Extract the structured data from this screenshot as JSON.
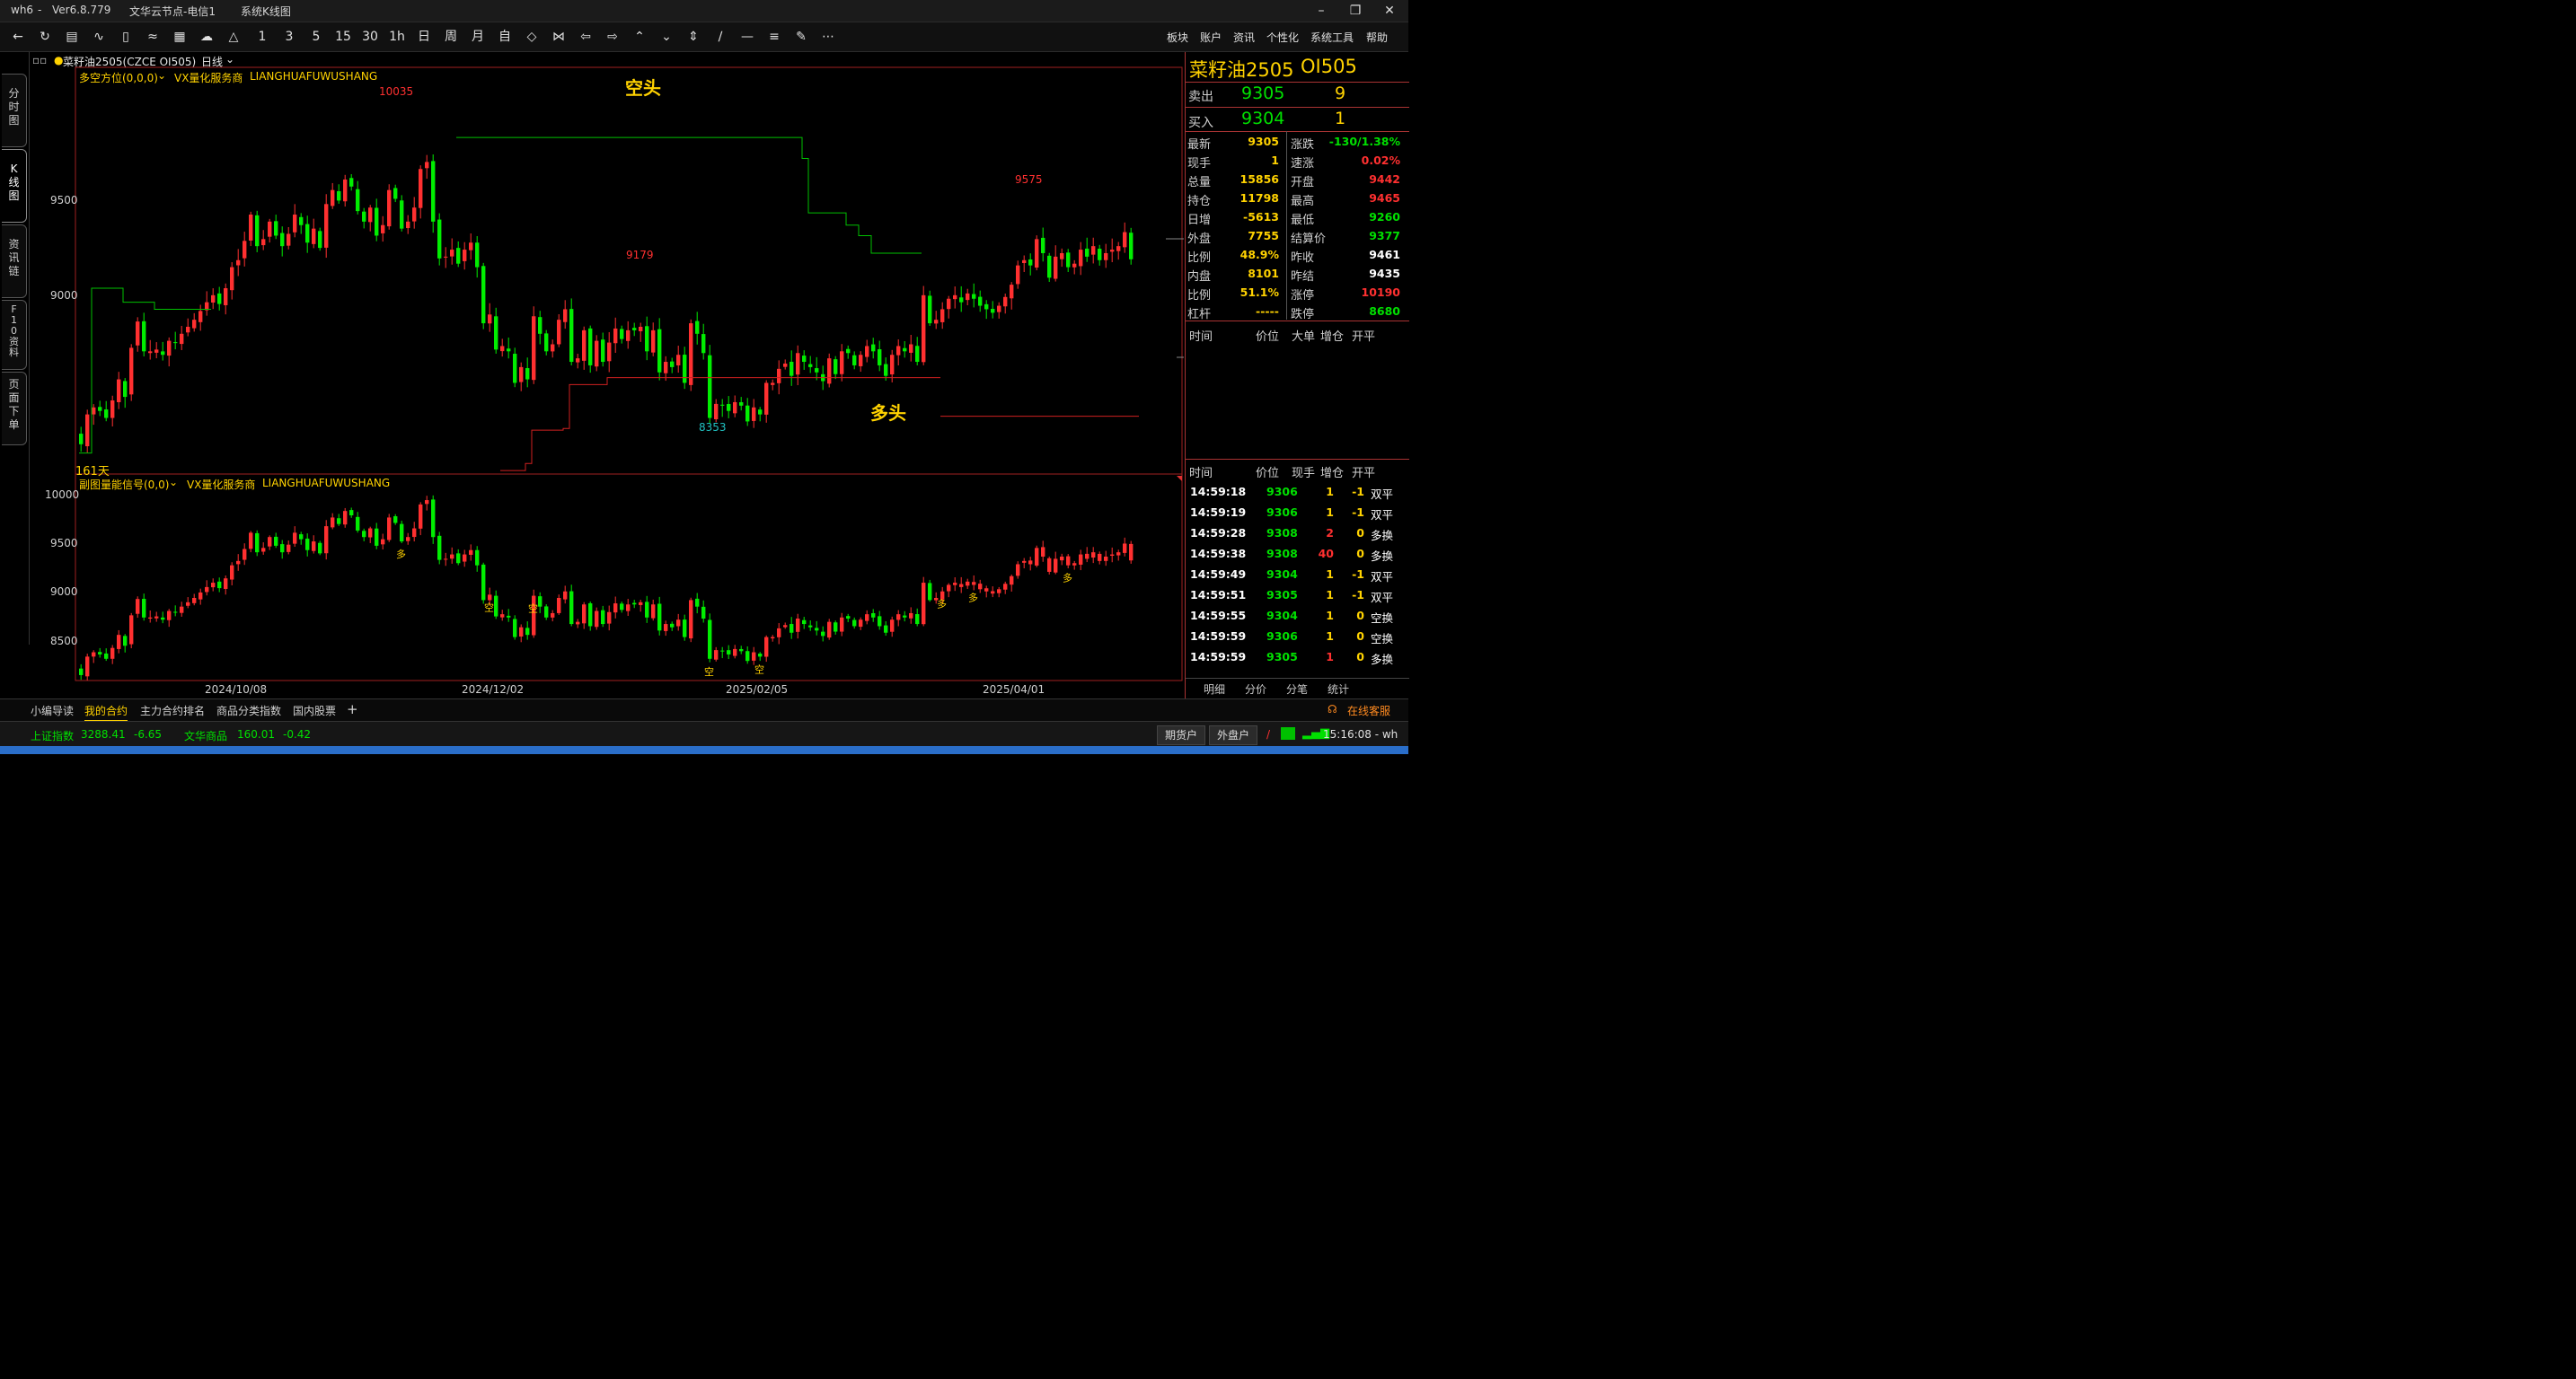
{
  "titlebar": {
    "app": "wh6",
    "sep": "-",
    "version": "Ver6.8.779",
    "server": "文华云节点-电信1",
    "view": "系统K线图"
  },
  "toolbar": {
    "periods": [
      "1",
      "3",
      "5",
      "15",
      "30",
      "1h",
      "日",
      "周",
      "月",
      "自"
    ],
    "menus": [
      "板块",
      "账户",
      "资讯",
      "个性化",
      "系统工具",
      "帮助"
    ]
  },
  "left_tabs": [
    "分\n时\n图",
    "K\n线\n图",
    "资\n讯\n链",
    "F\n1\n0\n资\n料",
    "页\n面\n下\n单"
  ],
  "chart_header": {
    "symbol": "菜籽油2505(CZCE OI505)",
    "period": "日线",
    "main_indicator": "多空方位(0,0,0)",
    "vendor": "VX量化服务商",
    "vendor_pinyin": "LIANGHUAFUWUSHANG",
    "bars_label": "161天",
    "sub_indicator": "副图量能信号(0,0)",
    "sub_vendor": "VX量化服务商",
    "sub_vendor_pinyin": "LIANGHUAFUWUSHANG"
  },
  "annotations": {
    "short_label": "空头",
    "long_label": "多头",
    "high1": "10035",
    "high2": "9179",
    "low1": "8353",
    "high3": "9575",
    "signal_long": "多",
    "signal_short": "空"
  },
  "main_axis": {
    "labels": [
      "9500",
      "9000"
    ]
  },
  "sub_axis": {
    "labels": [
      "10000",
      "9500",
      "9000",
      "8500"
    ]
  },
  "date_axis": {
    "labels": [
      "2024/10/08",
      "2024/12/02",
      "2025/02/05",
      "2025/04/01"
    ]
  },
  "chart_data": {
    "type": "candlestick",
    "main_ylim": [
      8080,
      10400
    ],
    "sub_ylim": [
      8200,
      10100
    ],
    "colors": {
      "up": "#ff3030",
      "down": "#00ee00",
      "short_line": "#00c000",
      "long_line": "#d02020"
    },
    "closes": [
      8250,
      8420,
      8460,
      8440,
      8400,
      8500,
      8620,
      8520,
      8800,
      8950,
      8780,
      8780,
      8790,
      8760,
      8840,
      8830,
      8880,
      8920,
      8960,
      9010,
      9060,
      9100,
      9050,
      9140,
      9260,
      9300,
      9410,
      9560,
      9380,
      9420,
      9520,
      9440,
      9380,
      9450,
      9560,
      9500,
      9400,
      9480,
      9370,
      9620,
      9700,
      9640,
      9760,
      9720,
      9580,
      9520,
      9600,
      9440,
      9500,
      9700,
      9650,
      9480,
      9520,
      9600,
      9820,
      9860,
      9520,
      9310,
      9320,
      9360,
      9280,
      9360,
      9400,
      9260,
      8940,
      8990,
      8790,
      8810,
      8780,
      8600,
      8690,
      8620,
      8980,
      8880,
      8780,
      8820,
      8960,
      9020,
      8720,
      8740,
      8900,
      8700,
      8840,
      8720,
      8830,
      8910,
      8850,
      8900,
      8900,
      8920,
      8780,
      8900,
      8660,
      8720,
      8690,
      8760,
      8600,
      8940,
      8880,
      8770,
      8400,
      8480,
      8470,
      8440,
      8490,
      8470,
      8380,
      8460,
      8420,
      8600,
      8600,
      8680,
      8710,
      8640,
      8770,
      8720,
      8690,
      8660,
      8610,
      8740,
      8650,
      8780,
      8770,
      8700,
      8760,
      8810,
      8780,
      8700,
      8640,
      8760,
      8810,
      8780,
      8820,
      8720,
      9100,
      8940,
      8960,
      9020,
      9080,
      9100,
      9060,
      9110,
      9080,
      9040,
      9020,
      9000,
      9040,
      9090,
      9160,
      9270,
      9300,
      9270,
      9420,
      9340,
      9200,
      9320,
      9340,
      9260,
      9280,
      9360,
      9320,
      9380,
      9300,
      9340,
      9360,
      9380,
      9460,
      9305
    ],
    "short_line": {
      "start_index": 60,
      "break_index": 136,
      "level_start": 10000,
      "steps": [
        [
          60,
          10000
        ],
        [
          114,
          10000
        ],
        [
          115,
          9880
        ],
        [
          116,
          9570
        ],
        [
          120,
          9570
        ],
        [
          122,
          9500
        ],
        [
          124,
          9440
        ],
        [
          126,
          9340
        ],
        [
          134,
          9340
        ]
      ]
    },
    "long_line": {
      "points": [
        [
          0,
          8200
        ],
        [
          1,
          8200
        ],
        [
          2,
          9140
        ],
        [
          6,
          9140
        ],
        [
          7,
          9060
        ],
        [
          11,
          9060
        ],
        [
          12,
          9020
        ],
        [
          21,
          9020
        ]
      ],
      "second": [
        [
          67,
          8100
        ],
        [
          70,
          8100
        ],
        [
          71,
          8140
        ],
        [
          72,
          8330
        ],
        [
          77,
          8340
        ],
        [
          78,
          8590
        ],
        [
          83,
          8590
        ],
        [
          84,
          8630
        ],
        [
          101,
          8630
        ],
        [
          137,
          8630
        ]
      ]
    },
    "long_level": 8410,
    "sub_signals": [
      [
        51,
        "多"
      ],
      [
        65,
        "空"
      ],
      [
        72,
        "空"
      ],
      [
        100,
        "空"
      ],
      [
        108,
        "空"
      ],
      [
        137,
        "多"
      ],
      [
        142,
        "多"
      ],
      [
        157,
        "多"
      ]
    ]
  },
  "quote": {
    "title": "菜籽油2505",
    "code": "OI505",
    "ask_label": "卖出",
    "ask_price": "9305",
    "ask_vol": "9",
    "bid_label": "买入",
    "bid_price": "9304",
    "bid_vol": "1",
    "rows": [
      {
        "l1": "最新",
        "v1": "9305",
        "c1": "y",
        "l2": "涨跌",
        "v2": "-130/1.38%",
        "c2": "g"
      },
      {
        "l1": "现手",
        "v1": "1",
        "c1": "y",
        "l2": "速涨",
        "v2": "0.02%",
        "c2": "r"
      },
      {
        "l1": "总量",
        "v1": "15856",
        "c1": "y",
        "l2": "开盘",
        "v2": "9442",
        "c2": "r"
      },
      {
        "l1": "持仓",
        "v1": "11798",
        "c1": "y",
        "l2": "最高",
        "v2": "9465",
        "c2": "r"
      },
      {
        "l1": "日增",
        "v1": "-5613",
        "c1": "y",
        "l2": "最低",
        "v2": "9260",
        "c2": "g"
      },
      {
        "l1": "外盘",
        "v1": "7755",
        "c1": "y",
        "l2": "结算价",
        "v2": "9377",
        "c2": "g"
      },
      {
        "l1": "比例",
        "v1": "48.9%",
        "c1": "y",
        "l2": "昨收",
        "v2": "9461",
        "c2": "w"
      },
      {
        "l1": "内盘",
        "v1": "8101",
        "c1": "y",
        "l2": "昨结",
        "v2": "9435",
        "c2": "w"
      },
      {
        "l1": "比例",
        "v1": "51.1%",
        "c1": "y",
        "l2": "涨停",
        "v2": "10190",
        "c2": "r"
      },
      {
        "l1": "杠杆",
        "v1": "-----",
        "c1": "y",
        "l2": "跌停",
        "v2": "8680",
        "c2": "g"
      }
    ],
    "bigorder_header": [
      "时间",
      "价位",
      "大单",
      "增仓",
      "开平"
    ],
    "tick_header": [
      "时间",
      "价位",
      "现手",
      "增仓",
      "开平"
    ],
    "ticks": [
      {
        "t": "14:59:18",
        "p": "9306",
        "v": "1",
        "vc": "y",
        "d": "-1",
        "k": "双平"
      },
      {
        "t": "14:59:19",
        "p": "9306",
        "v": "1",
        "vc": "y",
        "d": "-1",
        "k": "双平"
      },
      {
        "t": "14:59:28",
        "p": "9308",
        "v": "2",
        "vc": "r",
        "d": "0",
        "k": "多换"
      },
      {
        "t": "14:59:38",
        "p": "9308",
        "v": "40",
        "vc": "r",
        "d": "0",
        "k": "多换"
      },
      {
        "t": "14:59:49",
        "p": "9304",
        "v": "1",
        "vc": "y",
        "d": "-1",
        "k": "双平"
      },
      {
        "t": "14:59:51",
        "p": "9305",
        "v": "1",
        "vc": "y",
        "d": "-1",
        "k": "双平"
      },
      {
        "t": "14:59:55",
        "p": "9304",
        "v": "1",
        "vc": "y",
        "d": "0",
        "k": "空换"
      },
      {
        "t": "14:59:59",
        "p": "9306",
        "v": "1",
        "vc": "y",
        "d": "0",
        "k": "空换"
      },
      {
        "t": "14:59:59",
        "p": "9305",
        "v": "1",
        "vc": "r",
        "d": "0",
        "k": "多换"
      }
    ],
    "tabs": [
      "明细",
      "分价",
      "分笔",
      "统计"
    ]
  },
  "bottom_tabs": [
    "小编导读",
    "我的合约",
    "主力合约排名",
    "商品分类指数",
    "国内股票",
    "+"
  ],
  "bottom_right": "在线客服",
  "status": {
    "idx1_name": "上证指数",
    "idx1_val": "3288.41",
    "idx1_chg": "-6.65",
    "idx2_name": "文华商品",
    "idx2_val": "160.01",
    "idx2_chg": "-0.42",
    "btn1": "期货户",
    "btn2": "外盘户",
    "time": "15:16:08 - wh"
  }
}
